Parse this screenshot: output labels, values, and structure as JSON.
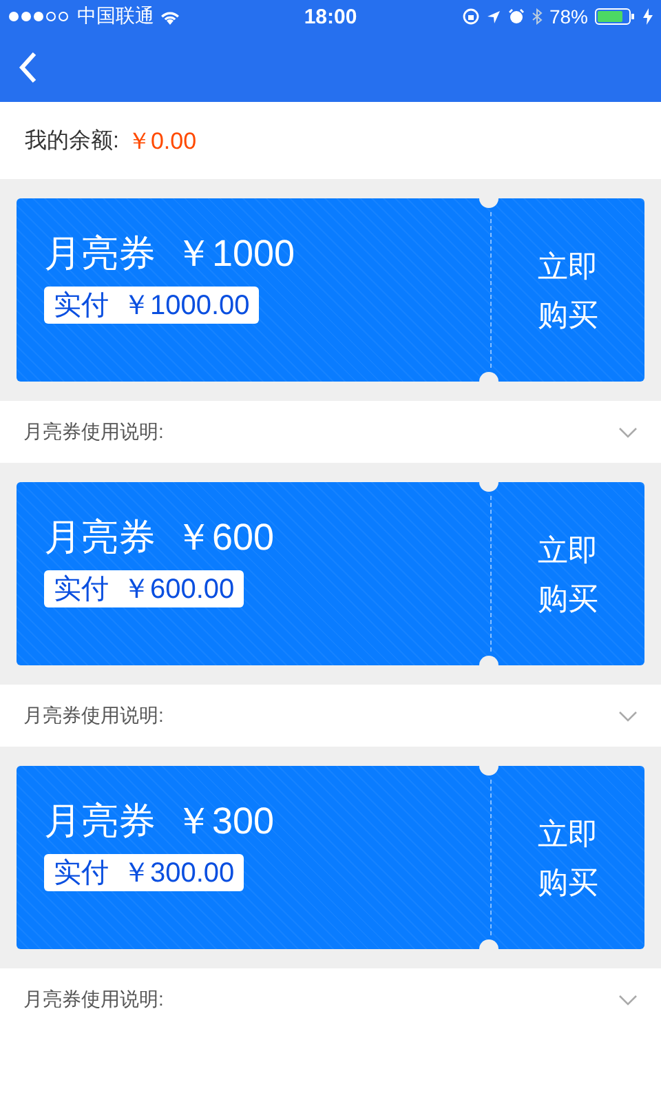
{
  "status_bar": {
    "carrier": "中国联通",
    "time": "18:00",
    "battery": "78%"
  },
  "balance": {
    "label": "我的余额:",
    "value": "￥0.00"
  },
  "coupons": [
    {
      "title": "月亮券",
      "price": "￥1000",
      "paid_label": "实付",
      "paid": "￥1000.00",
      "buy": "立即购买",
      "description": "月亮券使用说明:",
      "expanded": false
    },
    {
      "title": "月亮券",
      "price": "￥600",
      "paid_label": "实付",
      "paid": "￥600.00",
      "buy": "立即购买",
      "description": "月亮券使用说明:",
      "expanded": false
    },
    {
      "title": "月亮券",
      "price": "￥300",
      "paid_label": "实付",
      "paid": "￥300.00",
      "buy": "立即购买",
      "description": "月亮券使用说明:",
      "expanded": false
    }
  ]
}
